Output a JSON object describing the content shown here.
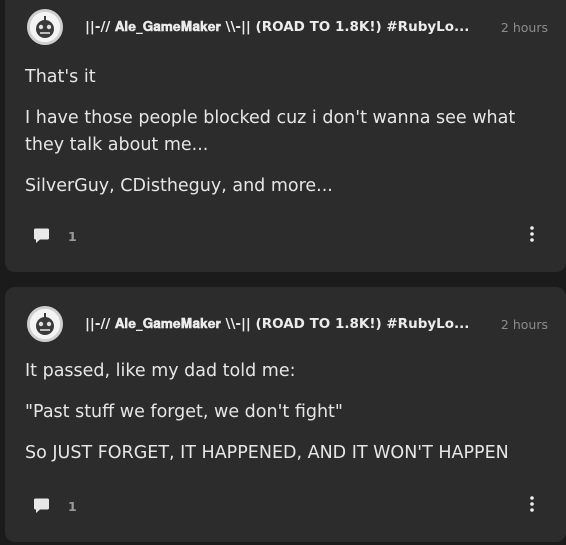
{
  "posts": [
    {
      "author": "||-// 𝐀𝐥𝐞_𝐆𝐚𝐦𝐞𝐌𝐚𝐤𝐞𝐫 \\\\-|| (ROAD TO 1.8K!) #RubyLo...",
      "timestamp": "2 hours",
      "paragraphs": [
        "That's it",
        "I have those people blocked cuz i don't wanna see what they talk about me...",
        "SilverGuy, CDistheguy, and more..."
      ],
      "reply_count": "1",
      "avatar_icon": "robot-avatar-icon",
      "reply_icon": "speech-bubble-icon",
      "more_icon": "vertical-ellipsis-icon"
    },
    {
      "author": "||-// 𝐀𝐥𝐞_𝐆𝐚𝐦𝐞𝐌𝐚𝐤𝐞𝐫 \\\\-|| (ROAD TO 1.8K!) #RubyLo...",
      "timestamp": "2 hours",
      "paragraphs": [
        "It passed, like my dad told me:",
        "\"Past stuff we forget, we don't fight\"",
        "So JUST FORGET, IT HAPPENED, AND IT WON'T HAPPEN"
      ],
      "reply_count": "1",
      "avatar_icon": "robot-avatar-icon",
      "reply_icon": "speech-bubble-icon",
      "more_icon": "vertical-ellipsis-icon"
    }
  ],
  "colors": {
    "page_background": "#1b1b1b",
    "card_background": "#2c2c2c",
    "text_primary": "#e6e6e6",
    "text_muted": "#8c8c8c"
  }
}
